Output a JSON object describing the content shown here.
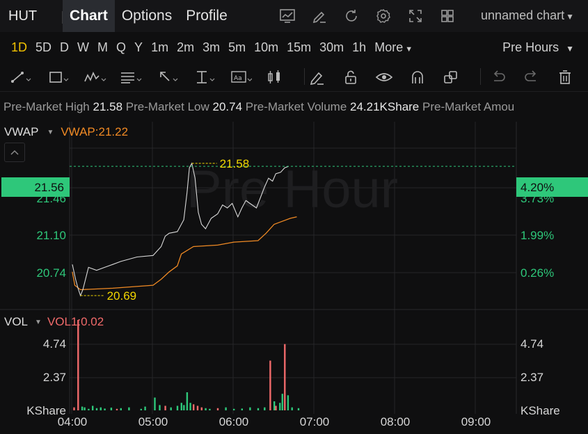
{
  "header": {
    "ticker": "HUT",
    "tabs": [
      {
        "label": "Chart",
        "active": true
      },
      {
        "label": "Options",
        "active": false
      },
      {
        "label": "Profile",
        "active": false
      }
    ],
    "chart_name": "unnamed chart",
    "icons": [
      "chart-settings-icon",
      "edit-icon",
      "refresh-icon",
      "gear-icon",
      "fullscreen-icon",
      "layout-grid-icon"
    ]
  },
  "intervals": {
    "items": [
      "1D",
      "5D",
      "D",
      "W",
      "M",
      "Q",
      "Y",
      "1m",
      "2m",
      "3m",
      "5m",
      "10m",
      "15m",
      "30m",
      "1h"
    ],
    "active": "1D",
    "more_label": "More",
    "session_label": "Pre Hours"
  },
  "draw_tools": [
    "trend-line-icon",
    "rectangle-icon",
    "pattern-icon",
    "fib-icon",
    "arrow-icon",
    "measure-icon",
    "text-note-icon",
    "candles-icon",
    "brush-icon",
    "lock-icon",
    "eye-icon",
    "magnet-icon",
    "duplicate-icon",
    "undo-icon",
    "redo-icon",
    "trash-icon"
  ],
  "stats": {
    "high_label": "Pre-Market High",
    "high_value": "21.58",
    "low_label": "Pre-Market Low",
    "low_value": "20.74",
    "volume_label": "Pre-Market Volume",
    "volume_value": "24.21KShare",
    "amount_label": "Pre-Market Amou"
  },
  "indicators": {
    "main_label": "VWAP",
    "main_value": "VWAP:21.22",
    "vol_label": "VOL",
    "vol_value": "VOL1:0.02"
  },
  "watermark": "Pre Hour",
  "colors": {
    "price_line": "#d9d9d9",
    "vwap_line": "#f08a24",
    "up": "#2ec77a",
    "down": "#f06a6a",
    "highlight": "#f2d600",
    "accent": "#f2c200"
  },
  "chart_data": {
    "type": "line",
    "title": "",
    "x_ticks": [
      "04:00",
      "05:00",
      "06:00",
      "07:00",
      "08:00",
      "09:00"
    ],
    "price_axis_left": [
      "21.46",
      "21.10",
      "20.74"
    ],
    "pct_axis_right": [
      "3.73%",
      "1.99%",
      "0.26%"
    ],
    "current_price": "21.56",
    "current_pct": "4.20%",
    "high_marker": "21.58",
    "low_marker": "20.69",
    "volume_axis": [
      "4.74",
      "2.37",
      "KShare"
    ],
    "ylim": [
      20.62,
      21.86
    ],
    "vol_max": 6.0,
    "price_series": [
      [
        0.0,
        20.9
      ],
      [
        0.04,
        20.8
      ],
      [
        0.07,
        20.74
      ],
      [
        0.1,
        20.69
      ],
      [
        0.13,
        20.73
      ],
      [
        0.2,
        20.88
      ],
      [
        0.3,
        20.86
      ],
      [
        0.4,
        20.88
      ],
      [
        0.5,
        20.9
      ],
      [
        0.6,
        20.92
      ],
      [
        0.8,
        20.95
      ],
      [
        1.0,
        20.96
      ],
      [
        1.1,
        21.02
      ],
      [
        1.15,
        21.09
      ],
      [
        1.2,
        21.11
      ],
      [
        1.3,
        21.12
      ],
      [
        1.38,
        21.2
      ],
      [
        1.42,
        21.38
      ],
      [
        1.45,
        21.55
      ],
      [
        1.48,
        21.58
      ],
      [
        1.52,
        21.48
      ],
      [
        1.56,
        21.25
      ],
      [
        1.6,
        21.17
      ],
      [
        1.65,
        21.14
      ],
      [
        1.72,
        21.21
      ],
      [
        1.8,
        21.24
      ],
      [
        1.86,
        21.3
      ],
      [
        1.92,
        21.28
      ],
      [
        1.98,
        21.31
      ],
      [
        2.05,
        21.22
      ],
      [
        2.1,
        21.28
      ],
      [
        2.15,
        21.33
      ],
      [
        2.2,
        21.31
      ],
      [
        2.28,
        21.28
      ],
      [
        2.33,
        21.35
      ],
      [
        2.38,
        21.42
      ],
      [
        2.43,
        21.48
      ],
      [
        2.48,
        21.46
      ],
      [
        2.52,
        21.51
      ],
      [
        2.58,
        21.52
      ],
      [
        2.63,
        21.55
      ],
      [
        2.68,
        21.56
      ]
    ],
    "vwap_series": [
      [
        0.0,
        20.85
      ],
      [
        0.03,
        20.76
      ],
      [
        0.1,
        20.73
      ],
      [
        0.5,
        20.74
      ],
      [
        1.0,
        20.76
      ],
      [
        1.1,
        20.8
      ],
      [
        1.2,
        20.85
      ],
      [
        1.3,
        20.89
      ],
      [
        1.35,
        20.97
      ],
      [
        1.5,
        21.02
      ],
      [
        1.8,
        21.03
      ],
      [
        2.0,
        21.05
      ],
      [
        2.3,
        21.06
      ],
      [
        2.4,
        21.11
      ],
      [
        2.5,
        21.17
      ],
      [
        2.6,
        21.19
      ],
      [
        2.7,
        21.21
      ],
      [
        2.78,
        21.22
      ]
    ],
    "volume_bars": [
      [
        0.02,
        0.2,
        "down"
      ],
      [
        0.07,
        6.0,
        "down"
      ],
      [
        0.12,
        0.25,
        "up"
      ],
      [
        0.15,
        0.2,
        "up"
      ],
      [
        0.2,
        0.1,
        "up"
      ],
      [
        0.25,
        0.3,
        "up"
      ],
      [
        0.3,
        0.15,
        "up"
      ],
      [
        0.35,
        0.2,
        "up"
      ],
      [
        0.4,
        0.12,
        "up"
      ],
      [
        0.48,
        0.18,
        "up"
      ],
      [
        0.55,
        0.1,
        "down"
      ],
      [
        0.6,
        0.15,
        "up"
      ],
      [
        0.7,
        0.2,
        "up"
      ],
      [
        0.85,
        0.1,
        "up"
      ],
      [
        0.9,
        0.25,
        "up"
      ],
      [
        1.02,
        0.85,
        "up"
      ],
      [
        1.08,
        0.35,
        "up"
      ],
      [
        1.15,
        0.3,
        "down"
      ],
      [
        1.22,
        0.2,
        "up"
      ],
      [
        1.3,
        0.3,
        "up"
      ],
      [
        1.35,
        0.5,
        "up"
      ],
      [
        1.38,
        0.35,
        "up"
      ],
      [
        1.42,
        1.2,
        "up"
      ],
      [
        1.46,
        0.5,
        "up"
      ],
      [
        1.5,
        0.4,
        "down"
      ],
      [
        1.55,
        0.3,
        "down"
      ],
      [
        1.6,
        0.2,
        "down"
      ],
      [
        1.65,
        0.15,
        "up"
      ],
      [
        1.7,
        0.1,
        "up"
      ],
      [
        1.8,
        0.15,
        "down"
      ],
      [
        1.9,
        0.2,
        "up"
      ],
      [
        2.0,
        0.1,
        "up"
      ],
      [
        2.1,
        0.12,
        "up"
      ],
      [
        2.2,
        0.2,
        "up"
      ],
      [
        2.3,
        0.15,
        "up"
      ],
      [
        2.38,
        0.2,
        "up"
      ],
      [
        2.45,
        3.3,
        "down"
      ],
      [
        2.5,
        0.6,
        "up"
      ],
      [
        2.52,
        0.3,
        "down"
      ],
      [
        2.57,
        0.5,
        "up"
      ],
      [
        2.6,
        1.1,
        "up"
      ],
      [
        2.63,
        4.4,
        "down"
      ],
      [
        2.67,
        1.0,
        "up"
      ],
      [
        2.72,
        0.2,
        "up"
      ],
      [
        2.8,
        0.15,
        "up"
      ]
    ]
  }
}
